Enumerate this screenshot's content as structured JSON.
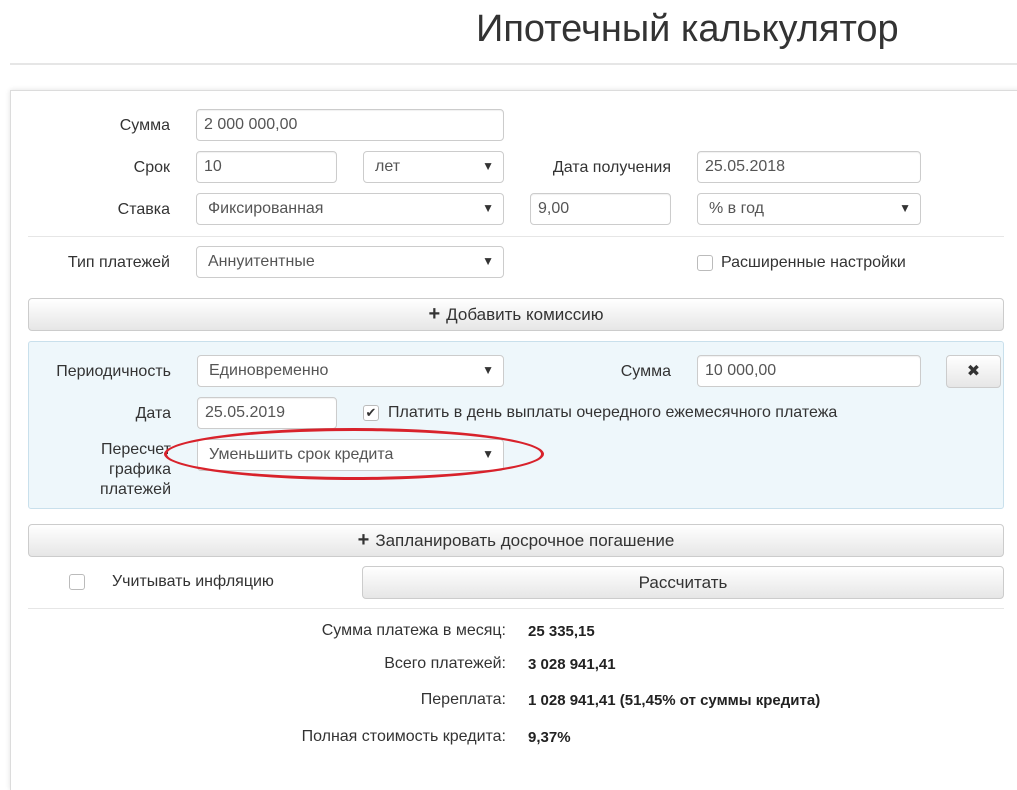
{
  "page": {
    "title": "Ипотечный калькулятор"
  },
  "form": {
    "sum_label": "Сумма",
    "sum_value": "2 000 000,00",
    "term_label": "Срок",
    "term_value": "10",
    "term_unit": "лет",
    "date_received_label": "Дата получения",
    "date_received_value": "25.05.2018",
    "rate_label": "Ставка",
    "rate_type": "Фиксированная",
    "rate_value": "9,00",
    "rate_unit": "% в год",
    "payment_type_label": "Тип платежей",
    "payment_type_value": "Аннуитентные",
    "advanced_settings_label": "Расширенные настройки",
    "advanced_settings_checked": false
  },
  "commission": {
    "add_button_label": "Добавить комиссию",
    "periodicity_label": "Периодичность",
    "periodicity_value": "Единовременно",
    "sum_label": "Сумма",
    "sum_value": "10 000,00",
    "date_label": "Дата",
    "date_value": "25.05.2019",
    "pay_on_payment_day_label": "Платить в день выплаты очередного ежемесячного платежа",
    "pay_on_payment_day_checked": true,
    "recalc_label_line1": "Пересчет",
    "recalc_label_line2": "графика",
    "recalc_label_line3": "платежей",
    "recalc_value": "Уменьшить срок кредита",
    "highlight_color": "#d8222b"
  },
  "actions": {
    "schedule_early_repayment_label": "Запланировать досрочное погашение",
    "inflation_label": "Учитывать инфляцию",
    "inflation_checked": false,
    "calculate_label": "Рассчитать"
  },
  "results": {
    "monthly_payment_label": "Сумма платежа в месяц:",
    "monthly_payment_value": "25 335,15",
    "total_payments_label": "Всего платежей:",
    "total_payments_value": "3 028 941,41",
    "overpayment_label": "Переплата:",
    "overpayment_value": "1 028 941,41 (51,45% от суммы кредита)",
    "full_cost_label": "Полная стоимость кредита:",
    "full_cost_value": "9,37%"
  },
  "icons": {
    "caret": "▼",
    "plus": "+",
    "close": "✖",
    "check": "✔"
  }
}
